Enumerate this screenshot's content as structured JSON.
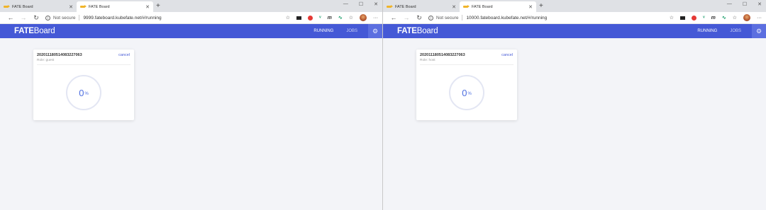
{
  "windows": [
    {
      "tabs": [
        {
          "title": "FATE Board"
        },
        {
          "title": "FATE Board"
        }
      ],
      "not_secure": "Not secure",
      "url": "9999.fateboard.kubefate.net/#/running",
      "brand_bold": "FATE",
      "brand_rest": "Board",
      "nav_running": "RUNNING",
      "nav_jobs": "JOBS",
      "job": {
        "id": "202011180514083227063",
        "cancel": "cancel",
        "role": "Role: guest",
        "progress_value": "0",
        "progress_unit": "%"
      }
    },
    {
      "tabs": [
        {
          "title": "FATE Board"
        },
        {
          "title": "FATE Board"
        }
      ],
      "not_secure": "Not secure",
      "url": "10000.fateboard.kubefate.net/#/running",
      "brand_bold": "FATE",
      "brand_rest": "Board",
      "nav_running": "RUNNING",
      "nav_jobs": "JOBS",
      "job": {
        "id": "202011180514083227063",
        "cancel": "cancel",
        "role": "Role: host",
        "progress_value": "0",
        "progress_unit": "%"
      }
    }
  ],
  "colors": {
    "header": "#4559d6",
    "progress_text": "#4d6ee0",
    "tab_favicon": "#f0b429"
  }
}
